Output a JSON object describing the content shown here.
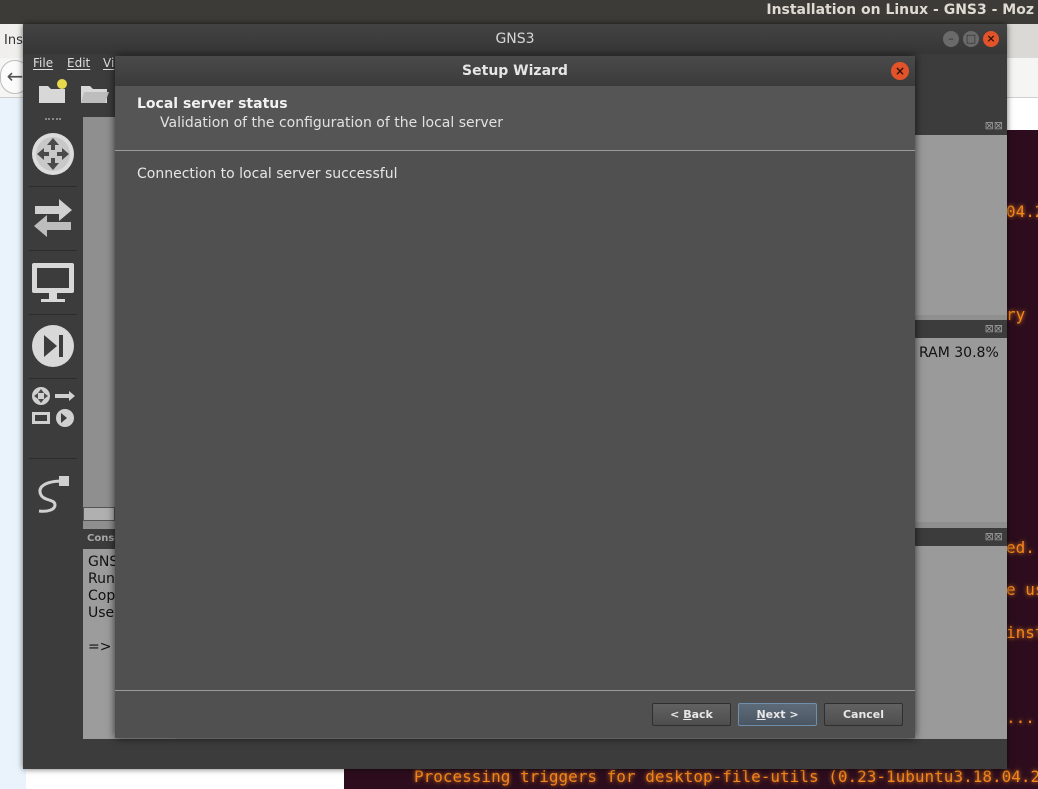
{
  "firefox": {
    "window_title": "Installation on Linux - GNS3 - Moz",
    "tab_fragment": "Ins",
    "back_glyph": "←"
  },
  "terminal": {
    "fragments": [
      "04.2",
      "ry",
      "ed.",
      "e us",
      "inst",
      "..."
    ],
    "bottom_line": "Processing triggers for desktop-file-utils (0.23-1ubuntu3.18.04.2"
  },
  "gns3": {
    "title": "GNS3",
    "menu": {
      "file": "File",
      "edit": "Edit",
      "view": "Vi"
    },
    "resources": {
      "ram": "RAM 30.8%"
    },
    "console": {
      "header": "Conso",
      "lines": [
        "GNS",
        "Run",
        "Cop",
        "Use",
        "",
        "=>"
      ]
    },
    "window_buttons": {
      "minimize": "–",
      "maximize": "□",
      "close": "×"
    }
  },
  "wizard": {
    "title": "Setup Wizard",
    "header_title": "Local server status",
    "header_subtitle": "Validation of the configuration of the local server",
    "message": "Connection to local server successful",
    "buttons": {
      "back": {
        "prefix": "< ",
        "mnemonic": "B",
        "rest": "ack"
      },
      "next": {
        "mnemonic": "N",
        "rest": "ext >"
      },
      "cancel": "Cancel"
    },
    "close_glyph": "×"
  },
  "colors": {
    "accent_close": "#e2532a",
    "terminal_text": "#f3871b",
    "dialog_bg": "#505050"
  }
}
